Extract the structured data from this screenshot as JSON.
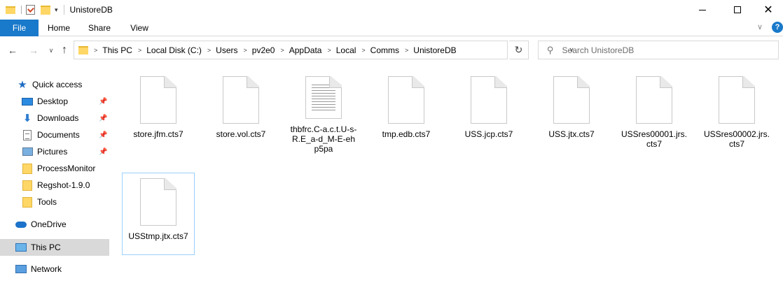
{
  "titlebar": {
    "title": "UnistoreDB",
    "qat_dropdown_glyph": "▾"
  },
  "ribbon": {
    "tabs": [
      "File",
      "Home",
      "Share",
      "View"
    ],
    "help_glyph": "?"
  },
  "nav": {
    "back_glyph": "←",
    "forward_glyph": "→",
    "recent_glyph": "∨",
    "up_glyph": "↑",
    "breadcrumbs": [
      "This PC",
      "Local Disk (C:)",
      "Users",
      "pv2e0",
      "AppData",
      "Local",
      "Comms",
      "UnistoreDB"
    ],
    "refresh_glyph": "↻",
    "search_placeholder": "Search UnistoreDB"
  },
  "sidebar": {
    "items": [
      {
        "label": "Quick access",
        "icon": "star-icon",
        "pinned": false
      },
      {
        "label": "Desktop",
        "icon": "desktop-icon",
        "pinned": true
      },
      {
        "label": "Downloads",
        "icon": "download-icon",
        "pinned": true
      },
      {
        "label": "Documents",
        "icon": "documents-icon",
        "pinned": true
      },
      {
        "label": "Pictures",
        "icon": "pictures-icon",
        "pinned": true
      },
      {
        "label": "ProcessMonitor",
        "icon": "folder-icon",
        "pinned": false
      },
      {
        "label": "Regshot-1.9.0",
        "icon": "folder-icon",
        "pinned": false
      },
      {
        "label": "Tools",
        "icon": "folder-icon",
        "pinned": false
      },
      {
        "label": "OneDrive",
        "icon": "onedrive-icon",
        "pinned": false
      },
      {
        "label": "This PC",
        "icon": "this-pc-icon",
        "pinned": false,
        "selected": true
      },
      {
        "label": "Network",
        "icon": "network-icon",
        "pinned": false
      }
    ]
  },
  "files": [
    {
      "name": "store.jfm.cts7",
      "icon": "blank-file-icon"
    },
    {
      "name": "store.vol.cts7",
      "icon": "blank-file-icon"
    },
    {
      "name": "thbfrc.C-a.c.t.U-s-R.E_a-d_M-E-eh p5pa",
      "icon": "text-file-icon"
    },
    {
      "name": "tmp.edb.cts7",
      "icon": "blank-file-icon"
    },
    {
      "name": "USS.jcp.cts7",
      "icon": "blank-file-icon"
    },
    {
      "name": "USS.jtx.cts7",
      "icon": "blank-file-icon"
    },
    {
      "name": "USSres00001.jrs.cts7",
      "icon": "blank-file-icon"
    },
    {
      "name": "USSres00002.jrs.cts7",
      "icon": "blank-file-icon"
    },
    {
      "name": "USStmp.jtx.cts7",
      "icon": "blank-file-icon",
      "selected": true
    }
  ],
  "colors": {
    "accent": "#1979ca",
    "selection_bg": "#d9d9d9",
    "selection_border": "#99d1ff",
    "folder": "#ffd766"
  }
}
